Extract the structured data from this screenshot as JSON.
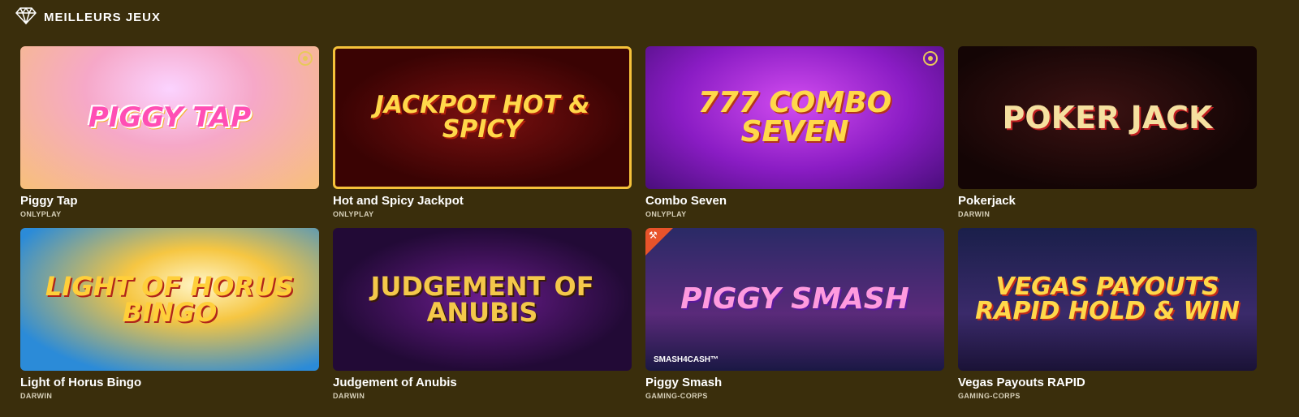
{
  "section": {
    "title": "MEILLEURS JEUX",
    "icon": "diamond-icon"
  },
  "accent": "#e8c85a",
  "games": [
    {
      "name": "Piggy Tap",
      "provider": "ONLYPLAY",
      "art": "PIGGY TAP",
      "favorite_icon": true
    },
    {
      "name": "Hot and Spicy Jackpot",
      "provider": "ONLYPLAY",
      "art": "JACKPOT HOT & SPICY"
    },
    {
      "name": "Combo Seven",
      "provider": "ONLYPLAY",
      "art": "777 COMBO Seven",
      "favorite_icon": true
    },
    {
      "name": "Pokerjack",
      "provider": "DARWIN",
      "art": "POKER JACK"
    },
    {
      "name": "Light of Horus Bingo",
      "provider": "DARWIN",
      "art": "LIGHT OF HORUS BINGO"
    },
    {
      "name": "Judgement of Anubis",
      "provider": "DARWIN",
      "art": "JUDGEMENT OF ANUBIS"
    },
    {
      "name": "Piggy Smash",
      "provider": "GAMING-CORPS",
      "art": "PIGGY SMASH",
      "sub_logo": "SMASH4CASH™"
    },
    {
      "name": "Vegas Payouts RAPID",
      "provider": "GAMING-CORPS",
      "art": "Vegas PAYOUTS RAPID HOLD & WIN"
    }
  ]
}
